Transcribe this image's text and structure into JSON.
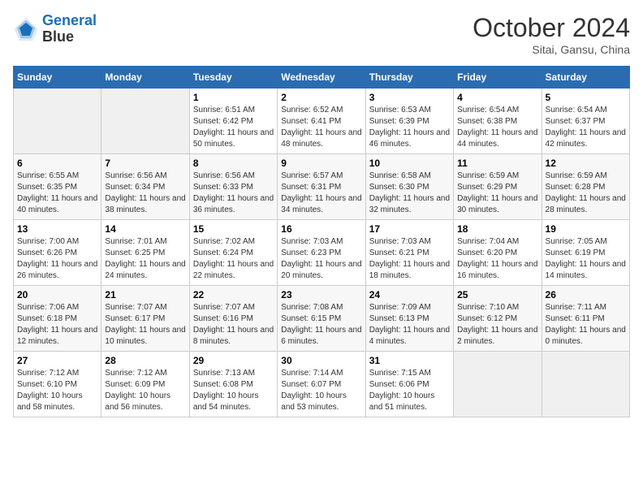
{
  "header": {
    "logo_line1": "General",
    "logo_line2": "Blue",
    "month_title": "October 2024",
    "subtitle": "Sitai, Gansu, China"
  },
  "weekdays": [
    "Sunday",
    "Monday",
    "Tuesday",
    "Wednesday",
    "Thursday",
    "Friday",
    "Saturday"
  ],
  "weeks": [
    [
      null,
      null,
      {
        "day": "1",
        "sunrise": "6:51 AM",
        "sunset": "6:42 PM",
        "daylight": "11 hours and 50 minutes."
      },
      {
        "day": "2",
        "sunrise": "6:52 AM",
        "sunset": "6:41 PM",
        "daylight": "11 hours and 48 minutes."
      },
      {
        "day": "3",
        "sunrise": "6:53 AM",
        "sunset": "6:39 PM",
        "daylight": "11 hours and 46 minutes."
      },
      {
        "day": "4",
        "sunrise": "6:54 AM",
        "sunset": "6:38 PM",
        "daylight": "11 hours and 44 minutes."
      },
      {
        "day": "5",
        "sunrise": "6:54 AM",
        "sunset": "6:37 PM",
        "daylight": "11 hours and 42 minutes."
      }
    ],
    [
      {
        "day": "6",
        "sunrise": "6:55 AM",
        "sunset": "6:35 PM",
        "daylight": "11 hours and 40 minutes."
      },
      {
        "day": "7",
        "sunrise": "6:56 AM",
        "sunset": "6:34 PM",
        "daylight": "11 hours and 38 minutes."
      },
      {
        "day": "8",
        "sunrise": "6:56 AM",
        "sunset": "6:33 PM",
        "daylight": "11 hours and 36 minutes."
      },
      {
        "day": "9",
        "sunrise": "6:57 AM",
        "sunset": "6:31 PM",
        "daylight": "11 hours and 34 minutes."
      },
      {
        "day": "10",
        "sunrise": "6:58 AM",
        "sunset": "6:30 PM",
        "daylight": "11 hours and 32 minutes."
      },
      {
        "day": "11",
        "sunrise": "6:59 AM",
        "sunset": "6:29 PM",
        "daylight": "11 hours and 30 minutes."
      },
      {
        "day": "12",
        "sunrise": "6:59 AM",
        "sunset": "6:28 PM",
        "daylight": "11 hours and 28 minutes."
      }
    ],
    [
      {
        "day": "13",
        "sunrise": "7:00 AM",
        "sunset": "6:26 PM",
        "daylight": "11 hours and 26 minutes."
      },
      {
        "day": "14",
        "sunrise": "7:01 AM",
        "sunset": "6:25 PM",
        "daylight": "11 hours and 24 minutes."
      },
      {
        "day": "15",
        "sunrise": "7:02 AM",
        "sunset": "6:24 PM",
        "daylight": "11 hours and 22 minutes."
      },
      {
        "day": "16",
        "sunrise": "7:03 AM",
        "sunset": "6:23 PM",
        "daylight": "11 hours and 20 minutes."
      },
      {
        "day": "17",
        "sunrise": "7:03 AM",
        "sunset": "6:21 PM",
        "daylight": "11 hours and 18 minutes."
      },
      {
        "day": "18",
        "sunrise": "7:04 AM",
        "sunset": "6:20 PM",
        "daylight": "11 hours and 16 minutes."
      },
      {
        "day": "19",
        "sunrise": "7:05 AM",
        "sunset": "6:19 PM",
        "daylight": "11 hours and 14 minutes."
      }
    ],
    [
      {
        "day": "20",
        "sunrise": "7:06 AM",
        "sunset": "6:18 PM",
        "daylight": "11 hours and 12 minutes."
      },
      {
        "day": "21",
        "sunrise": "7:07 AM",
        "sunset": "6:17 PM",
        "daylight": "11 hours and 10 minutes."
      },
      {
        "day": "22",
        "sunrise": "7:07 AM",
        "sunset": "6:16 PM",
        "daylight": "11 hours and 8 minutes."
      },
      {
        "day": "23",
        "sunrise": "7:08 AM",
        "sunset": "6:15 PM",
        "daylight": "11 hours and 6 minutes."
      },
      {
        "day": "24",
        "sunrise": "7:09 AM",
        "sunset": "6:13 PM",
        "daylight": "11 hours and 4 minutes."
      },
      {
        "day": "25",
        "sunrise": "7:10 AM",
        "sunset": "6:12 PM",
        "daylight": "11 hours and 2 minutes."
      },
      {
        "day": "26",
        "sunrise": "7:11 AM",
        "sunset": "6:11 PM",
        "daylight": "11 hours and 0 minutes."
      }
    ],
    [
      {
        "day": "27",
        "sunrise": "7:12 AM",
        "sunset": "6:10 PM",
        "daylight": "10 hours and 58 minutes."
      },
      {
        "day": "28",
        "sunrise": "7:12 AM",
        "sunset": "6:09 PM",
        "daylight": "10 hours and 56 minutes."
      },
      {
        "day": "29",
        "sunrise": "7:13 AM",
        "sunset": "6:08 PM",
        "daylight": "10 hours and 54 minutes."
      },
      {
        "day": "30",
        "sunrise": "7:14 AM",
        "sunset": "6:07 PM",
        "daylight": "10 hours and 53 minutes."
      },
      {
        "day": "31",
        "sunrise": "7:15 AM",
        "sunset": "6:06 PM",
        "daylight": "10 hours and 51 minutes."
      },
      null,
      null
    ]
  ]
}
